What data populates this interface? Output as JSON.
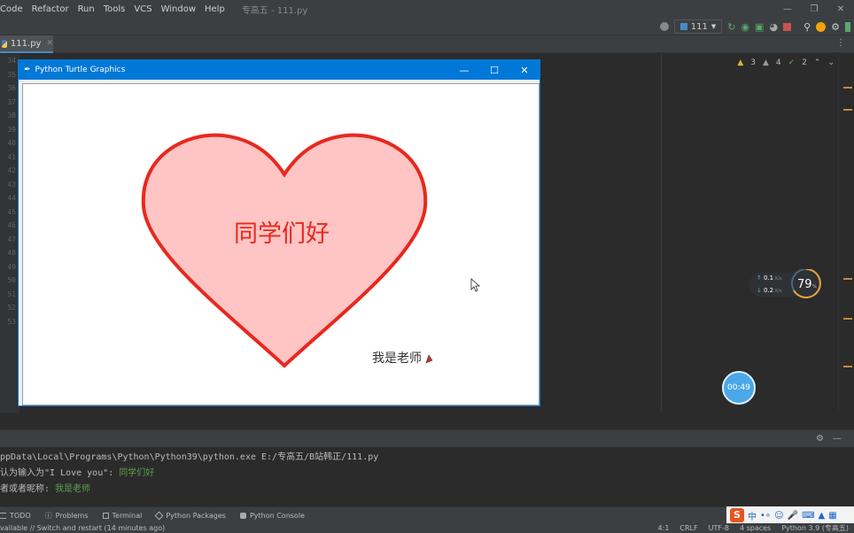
{
  "menubar": {
    "items": [
      "Code",
      "Refactor",
      "Run",
      "Tools",
      "VCS",
      "Window",
      "Help"
    ],
    "project_title": "专高五 - 111.py"
  },
  "toolbar": {
    "run_config": "111"
  },
  "editor": {
    "tab_label": "111.py",
    "line_numbers": [
      "34",
      "35",
      "36",
      "37",
      "38",
      "39",
      "40",
      "41",
      "42",
      "43",
      "44",
      "45",
      "46",
      "47",
      "48",
      "49",
      "50",
      "51",
      "52",
      "53"
    ],
    "inspections": {
      "warnings_a": "3",
      "warnings_b": "4",
      "ok": "2"
    }
  },
  "turtle_window": {
    "title": "Python Turtle Graphics",
    "heart_fill": "#ffc4c4",
    "heart_stroke": "#e8281e",
    "heart_text": "同学们好",
    "signature": "我是老师"
  },
  "network_widget": {
    "upload": "0.1",
    "download": "0.2",
    "unit": "K/s",
    "percent": "79",
    "percent_unit": "%"
  },
  "timer": "00:49",
  "console": {
    "command": "ppData\\Local\\Programs\\Python\\Python39\\python.exe E:/专高五/B站韩正/111.py",
    "line2_prefix": "认为输入为\"I Love you\": ",
    "line2_value": "同学们好",
    "line3_prefix": "者或者昵称: ",
    "line3_value": "我是老师"
  },
  "toolwindows": [
    "TODO",
    "Problems",
    "Terminal",
    "Python Packages",
    "Python Console"
  ],
  "ime": {
    "logo": "S",
    "mode": "中"
  },
  "statusbar": {
    "message": "vailable // Switch and restart (14 minutes ago)",
    "position": "4:1",
    "line_sep": "CRLF",
    "encoding": "UTF-8",
    "indent": "4 spaces",
    "interpreter": "Python 3.9 (专高五)"
  }
}
